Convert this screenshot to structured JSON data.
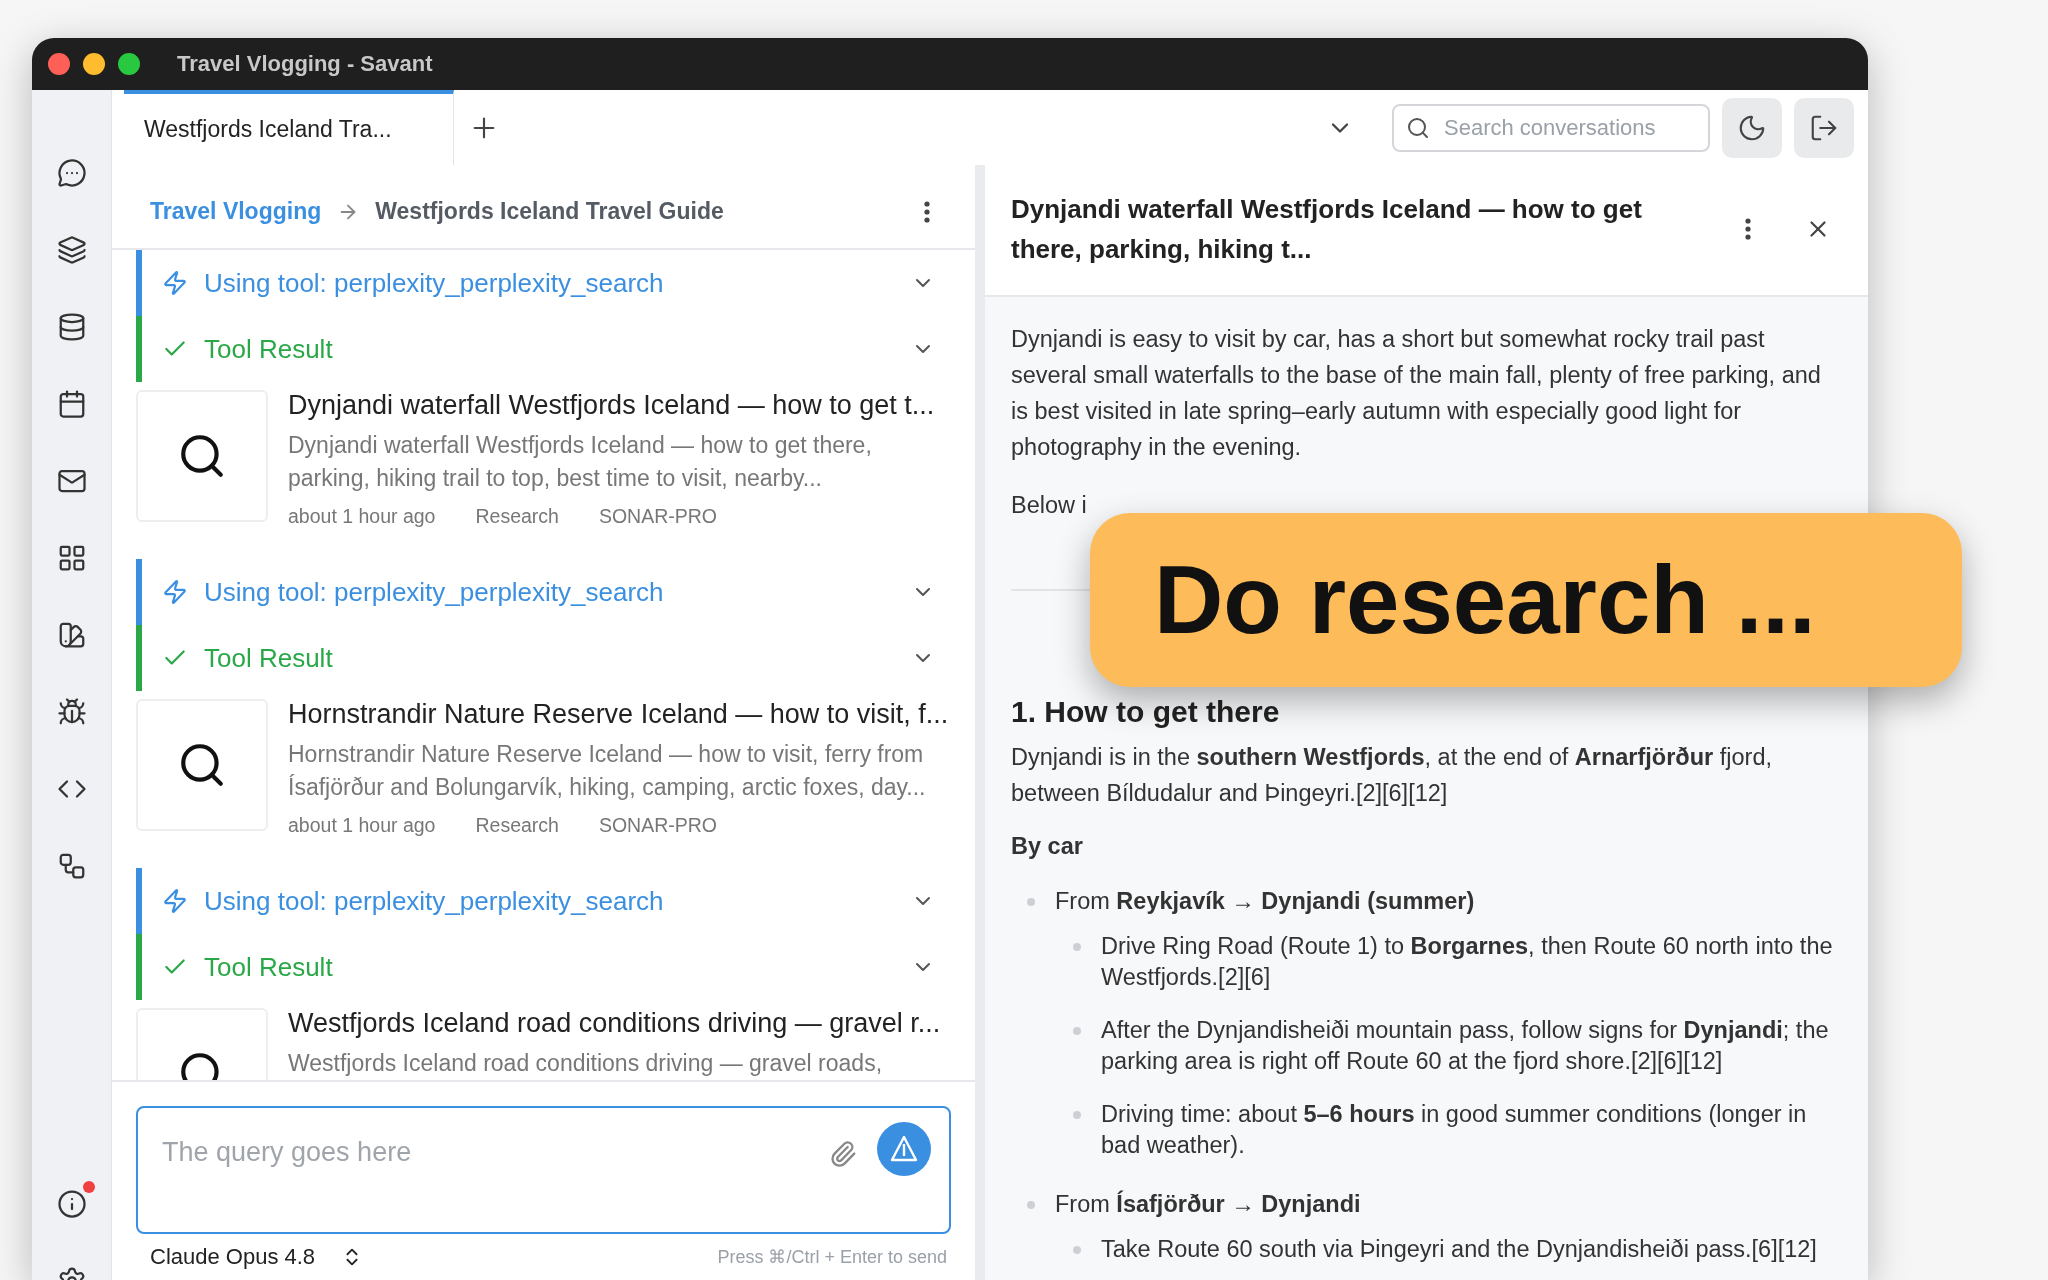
{
  "window": {
    "title": "Travel Vlogging - Savant"
  },
  "sidebar": {
    "info_alert": true
  },
  "tabs": [
    {
      "label": "Westfjords Iceland Tra...",
      "selected": true
    }
  ],
  "search": {
    "placeholder": "Search conversations"
  },
  "breadcrumb": [
    "Travel Vlogging",
    "Westfjords Iceland Travel Guide"
  ],
  "messages": [
    {
      "kind": "tool_call",
      "label": "Using tool: perplexity_perplexity_search"
    },
    {
      "kind": "tool_result",
      "label": "Tool Result"
    },
    {
      "kind": "result_card",
      "title": "Dynjandi waterfall Westfjords Iceland — how to get t...",
      "snippet": "Dynjandi waterfall Westfjords Iceland — how to get there, parking, hiking trail to top, best time to visit, nearby...",
      "meta": [
        "about 1 hour ago",
        "Research",
        "SONAR-PRO"
      ]
    },
    {
      "kind": "tool_call",
      "label": "Using tool: perplexity_perplexity_search"
    },
    {
      "kind": "tool_result",
      "label": "Tool Result"
    },
    {
      "kind": "result_card",
      "title": "Hornstrandir Nature Reserve Iceland — how to visit, f...",
      "snippet": "Hornstrandir Nature Reserve Iceland — how to visit, ferry from Ísafjörður and Bolungarvík, hiking, camping, arctic foxes, day...",
      "meta": [
        "about 1 hour ago",
        "Research",
        "SONAR-PRO"
      ]
    },
    {
      "kind": "tool_call",
      "label": "Using tool: perplexity_perplexity_search"
    },
    {
      "kind": "tool_result",
      "label": "Tool Result"
    },
    {
      "kind": "result_card",
      "title": "Westfjords Iceland road conditions driving — gravel r...",
      "snippet": "Westfjords Iceland road conditions driving — gravel roads,"
    }
  ],
  "composer": {
    "placeholder": "The query goes here",
    "model": "Claude Opus 4.8",
    "hint": "Press ⌘/Ctrl + Enter to send"
  },
  "detail": {
    "title": "Dynjandi waterfall Westfjords Iceland — how to get there, parking, hiking t...",
    "blocks": [
      {
        "kind": "paragraph",
        "text": "Dynjandi is easy to visit by car, has a short but somewhat rocky trail past several small waterfalls to the base of the main fall, plenty of free parking, and is best visited in late spring–early autumn with especially good light for photography in the evening."
      },
      {
        "kind": "paragraph",
        "text": "Below i"
      },
      {
        "kind": "rule"
      },
      {
        "kind": "heading",
        "text": "1. How to get there"
      },
      {
        "kind": "paragraph",
        "text": "Dynjandi is in the **southern Westfjords**, at the end of **Arnarfjörður** fjord, between Bíldudalur and Þingeyri.[2][6][12]"
      },
      {
        "kind": "subheading",
        "text": "By car"
      },
      {
        "kind": "bullet",
        "text": "From **Reykjavík → Dynjandi (summer)**",
        "children": [
          {
            "text": "Drive Ring Road (Route 1) to **Borgarnes**, then Route 60 north into the Westfjords.[2][6]"
          },
          {
            "text": "After the Dynjandisheiði mountain pass, follow signs for **Dynjandi**; the parking area is right off Route 60 at the fjord shore.[2][6][12]"
          },
          {
            "text": "Driving time: about **5–6 hours** in good summer conditions (longer in bad weather)."
          }
        ]
      },
      {
        "kind": "bullet",
        "text": "From **Ísafjörður → Dynjandi**",
        "children": [
          {
            "text": "Take Route 60 south via Þingeyri and the Dynjandisheiði pass.[6][12]"
          }
        ]
      }
    ]
  },
  "callout": {
    "text": "Do research ..."
  }
}
